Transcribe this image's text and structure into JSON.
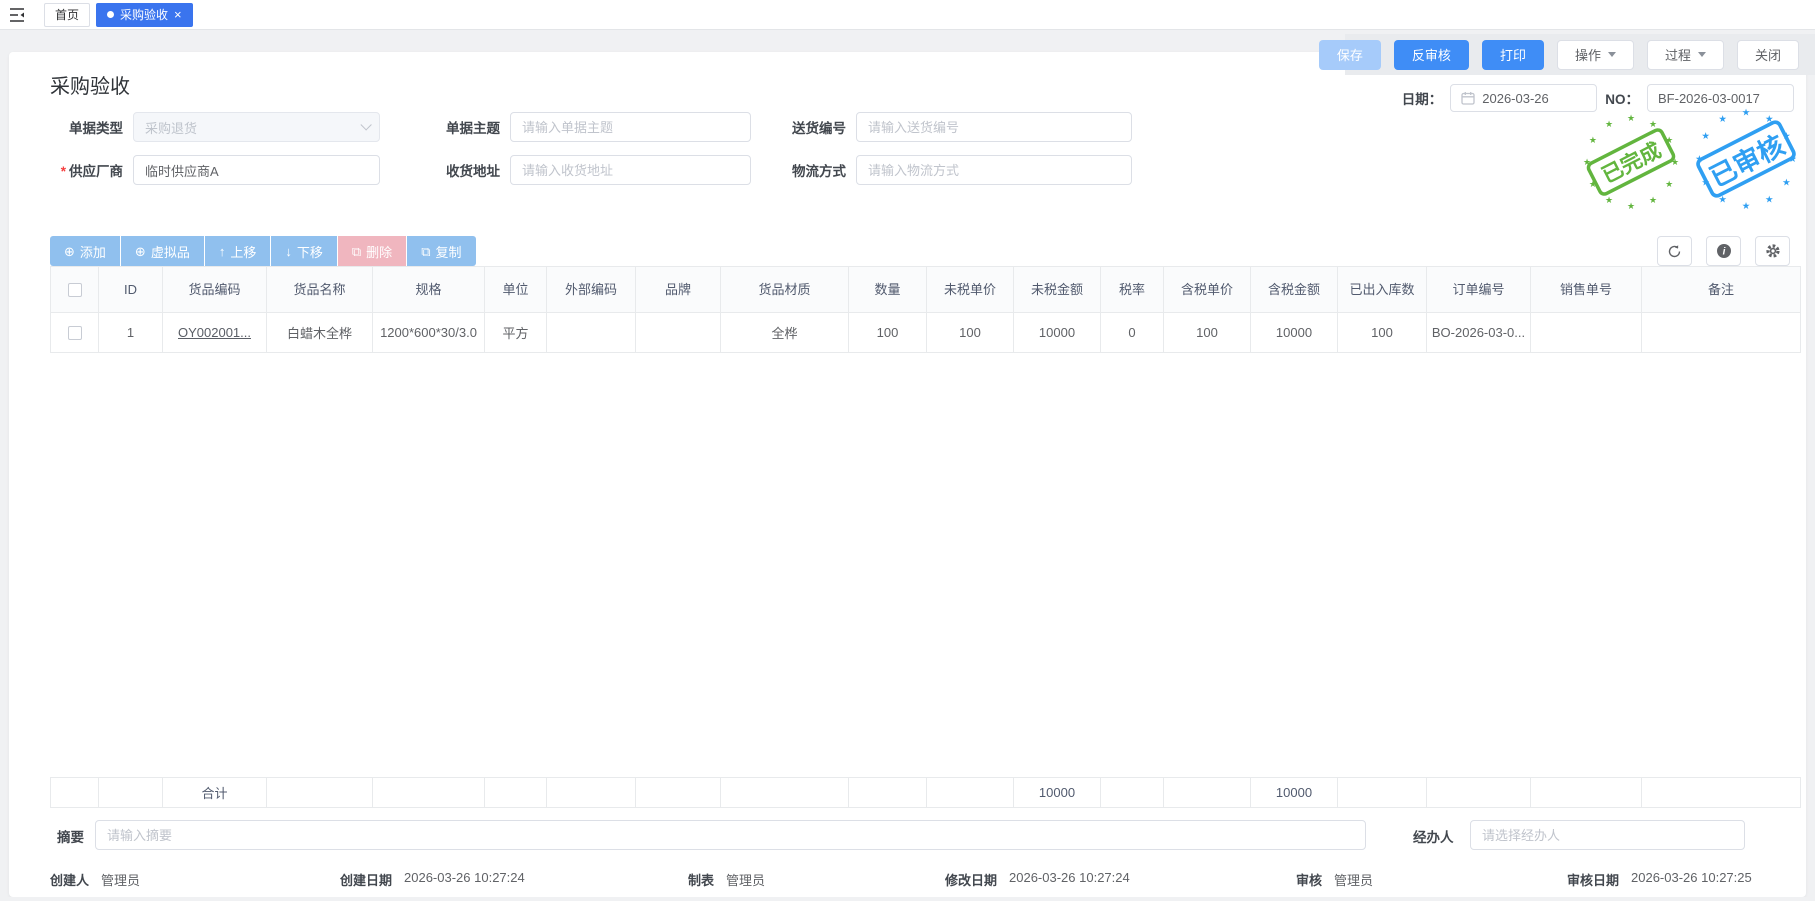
{
  "topbar": {
    "tabs": [
      {
        "label": "首页"
      },
      {
        "label": "采购验收"
      }
    ]
  },
  "actions": {
    "save": "保存",
    "unaudit": "反审核",
    "print": "打印",
    "operate": "操作",
    "process": "过程",
    "close": "关闭"
  },
  "header": {
    "title": "采购验收",
    "date_label": "日期：",
    "date_value": "2026-03-26",
    "no_label": "NO：",
    "no_value": "BF-2026-03-0017"
  },
  "form": {
    "doc_type": {
      "label": "单据类型",
      "value": "采购退货"
    },
    "doc_subject": {
      "label": "单据主题",
      "placeholder": "请输入单据主题"
    },
    "delivery_no": {
      "label": "送货编号",
      "placeholder": "请输入送货编号"
    },
    "supplier": {
      "label": "供应厂商",
      "value": "临时供应商A"
    },
    "receive_address": {
      "label": "收货地址",
      "placeholder": "请输入收货地址"
    },
    "logistics": {
      "label": "物流方式",
      "placeholder": "请输入物流方式"
    }
  },
  "stamps": [
    {
      "text": "已完成",
      "color": "#62b53e"
    },
    {
      "text": "已审核",
      "color": "#2f9ff2"
    }
  ],
  "grid_toolbar": {
    "add": "添加",
    "virtual": "虚拟品",
    "move_up": "上移",
    "move_down": "下移",
    "delete": "删除",
    "copy": "复制"
  },
  "table": {
    "columns": [
      "ID",
      "货品编码",
      "货品名称",
      "规格",
      "单位",
      "外部编码",
      "品牌",
      "货品材质",
      "数量",
      "未税单价",
      "未税金额",
      "税率",
      "含税单价",
      "含税金额",
      "已出入库数",
      "订单编号",
      "销售单号",
      "备注"
    ],
    "rows": [
      {
        "cells": [
          "1",
          "OY002001...",
          "白蜡木全桦",
          "1200*600*30/3.0",
          "平方",
          "",
          "",
          "全桦",
          "100",
          "100",
          "10000",
          "0",
          "100",
          "10000",
          "100",
          "BO-2026-03-0...",
          "",
          ""
        ]
      }
    ],
    "totals": {
      "label": "合计",
      "untaxed_amount": "10000",
      "taxed_amount": "10000"
    }
  },
  "summary": {
    "label": "摘要",
    "placeholder": "请输入摘要"
  },
  "agent": {
    "label": "经办人",
    "placeholder": "请选择经办人"
  },
  "footer_meta": [
    {
      "label": "创建人",
      "value": "管理员"
    },
    {
      "label": "创建日期",
      "value": "2026-03-26 10:27:24"
    },
    {
      "label": "制表",
      "value": "管理员"
    },
    {
      "label": "修改日期",
      "value": "2026-03-26 10:27:24"
    },
    {
      "label": "审核",
      "value": "管理员"
    },
    {
      "label": "审核日期",
      "value": "2026-03-26 10:27:25"
    }
  ]
}
